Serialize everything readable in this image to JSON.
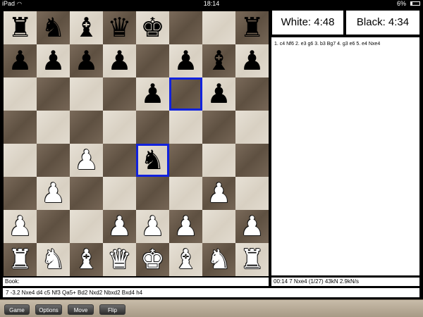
{
  "status_bar": {
    "carrier": "iPad",
    "time": "18:14",
    "battery": "6%"
  },
  "clocks": {
    "white": "White: 4:48",
    "black": "Black: 4:34"
  },
  "moves_text": "1. c4 Nf6 2. e3 g6 3. b3 Bg7 4. g3 e6 5. e4 Nxe4",
  "book_label": "Book:",
  "engine_stats": "00:14  7  Nxe4 (1/27)  43kN  2.9kN/s",
  "pv_line": "7 -3.2 Nxe4 d4 c5 Nf3 Qa5+ Bd2 Nxd2 Nbxd2 Bxd4 h4",
  "toolbar": {
    "game": "Game",
    "options": "Options",
    "move": "Move",
    "flip": "Flip"
  },
  "board": {
    "ranks": [
      [
        "r",
        "n",
        "b",
        "q",
        "k",
        "",
        "",
        "r"
      ],
      [
        "p",
        "p",
        "p",
        "p",
        "",
        "p",
        "b",
        "p"
      ],
      [
        "",
        "",
        "",
        "",
        "p",
        "",
        "p",
        ""
      ],
      [
        "",
        "",
        "",
        "",
        "",
        "",
        "",
        ""
      ],
      [
        "",
        "",
        "P",
        "",
        "n",
        "",
        "",
        ""
      ],
      [
        "",
        "P",
        "",
        "",
        "",
        "",
        "P",
        ""
      ],
      [
        "P",
        "",
        "",
        "P",
        "P",
        "P",
        "",
        "P"
      ],
      [
        "R",
        "N",
        "B",
        "Q",
        "K",
        "B",
        "N",
        "R"
      ]
    ],
    "highlights": [
      "f6",
      "e4"
    ],
    "highlight_color": "#1122dd",
    "light_color": "#e0d9cd",
    "dark_color": "#6a5b4c"
  }
}
